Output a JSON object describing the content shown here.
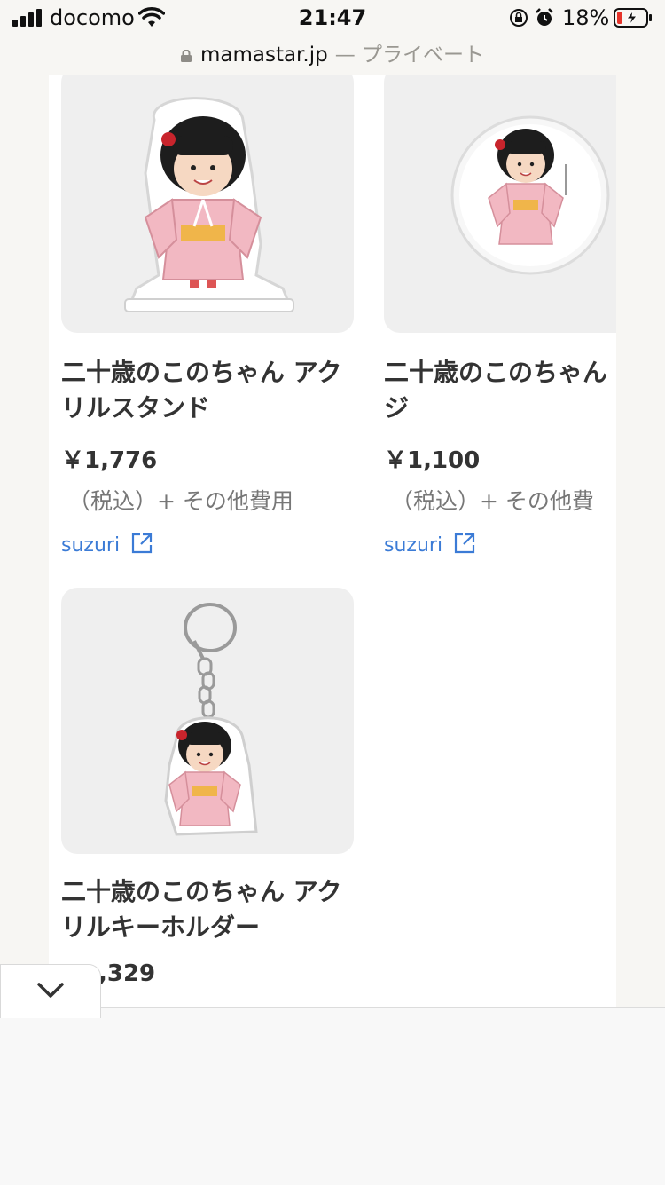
{
  "status_bar": {
    "carrier": "docomo",
    "time": "21:47",
    "battery_percent": "18%",
    "battery_level": 0.18,
    "icons": [
      "signal-icon",
      "wifi-icon",
      "orientation-lock-icon",
      "alarm-icon",
      "battery-charging-icon"
    ]
  },
  "url_bar": {
    "domain": "mamastar.jp",
    "mode": "— プライベート",
    "icon": "lock-icon"
  },
  "products": [
    {
      "title": "二十歳のこのちゃん アクリルスタンド",
      "price": "￥1,776",
      "tax_note": "（税込）+ その他費用",
      "store": "suzuri",
      "image": "acrylic-stand"
    },
    {
      "title": "二十歳のこのちゃん バッジ",
      "price": "￥1,100",
      "tax_note": "（税込）+ その他費",
      "store": "suzuri",
      "image": "badge"
    },
    {
      "title": "二十歳のこのちゃん アクリルキーホルダー",
      "price": ",329",
      "image": "keychain"
    }
  ],
  "toolbar": {
    "collapse_icon": "chevron-down-icon"
  },
  "colors": {
    "link": "#3b7bd6",
    "background": "#f7f6f3",
    "card_image_bg": "#efefef",
    "kimono_pink": "#f2b8c2"
  }
}
